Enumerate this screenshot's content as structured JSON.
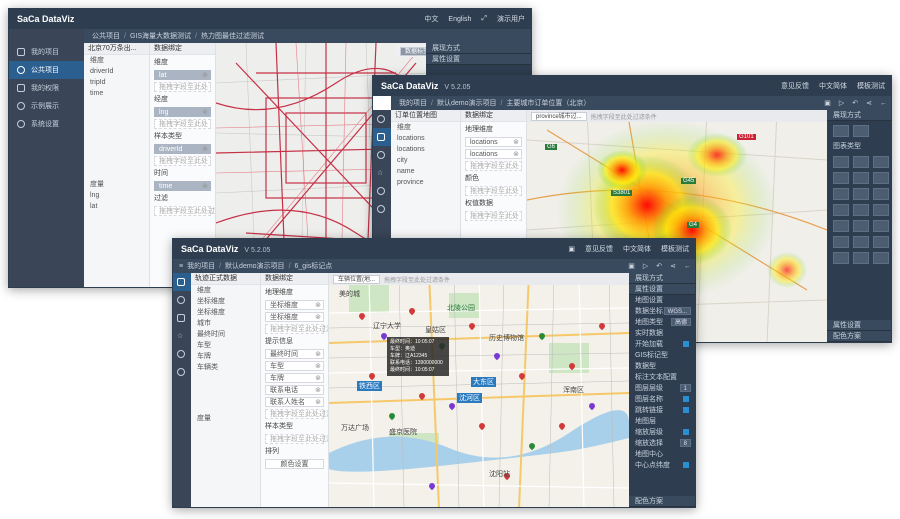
{
  "back": {
    "logo": "SaCa DataViz",
    "top": [
      "中文",
      "English",
      "演示用户"
    ],
    "crumbs": [
      "公共项目",
      "GIS海量大数据测试",
      "热力图最佳过滤测试"
    ],
    "nav": [
      "我的项目",
      "公共项目",
      "我的权限",
      "示例展示",
      "系统设置"
    ],
    "chart_title": "北京70万条出...",
    "dim_header": "维度",
    "dims": [
      "driverId",
      "tripId",
      "time"
    ],
    "measure_header": "度量",
    "measures": [
      "lng",
      "lat"
    ],
    "data_header": "数据绑定",
    "sec_dim": "维度",
    "f_lat": "lat",
    "sec_lng": "经度",
    "f_lng": "lng",
    "sec_style": "样本类型",
    "f_driver": "driverId",
    "sec_time": "时间",
    "f_time": "time",
    "sec_filter": "过滤",
    "drop_hint": "拖拽字段至此处",
    "drop_filter": "拖拽字段至此处过滤条件",
    "map_tabs": [
      "数据标签",
      "driverId筛选..."
    ],
    "right": [
      "展现方式",
      "属性设置"
    ]
  },
  "mid": {
    "logo": "SaCa DataViz",
    "version": "V 5.2.05",
    "top": [
      "意见反馈",
      "中文简体",
      "模板测试"
    ],
    "crumbs": [
      "我的项目",
      "默认demo演示项目",
      "主要城市订单位置（北京）"
    ],
    "chart_title": "订单位置地图",
    "dim_header": "维度",
    "dims": [
      "locations",
      "locations",
      "city",
      "name",
      "province"
    ],
    "measure_header": "度量",
    "data_header": "数据绑定",
    "sec_geo": "地理维度",
    "f_loc1": "locations",
    "f_loc2": "locations",
    "sec_color": "颜色",
    "sec_weight": "权值数据",
    "drop_hint": "拖拽字段至此处",
    "map_tabs": [
      "province城市过...",
      "拖拽字段至此处过滤条件"
    ],
    "right_header": "展现方式",
    "right_sec1": "图表类型",
    "right_sec2": "属性设置",
    "right_sec3": "配色方案",
    "roads": [
      "G101",
      "G6",
      "G45",
      "S3801",
      "G4"
    ]
  },
  "front": {
    "logo": "SaCa DataViz",
    "version": "V 5.2.05",
    "top": [
      "意见反馈",
      "中文简体",
      "模板测试"
    ],
    "crumbs": [
      "我的项目",
      "默认demo演示项目",
      "6_gis标记点"
    ],
    "chart_title": "轨迹正式数据",
    "dim_header": "维度",
    "dims": [
      "坐标维度",
      "坐标维度",
      "城市",
      "最终时间",
      "车型",
      "车牌",
      "车辆类"
    ],
    "measure_header": "度量",
    "data_header": "数据绑定",
    "sec_geo": "地理维度",
    "f_geo1": "坐标维度",
    "f_geo2": "坐标维度",
    "drop_hint": "拖拽字段至此处过滤条件",
    "sec_tip": "提示信息",
    "tips": [
      "最终时间",
      "车型",
      "车牌",
      "联系电话",
      "联系人姓名"
    ],
    "sec_style": "样本类型",
    "sec_show": "排列",
    "btn_save": "颜色设置",
    "map_tabs": [
      "车辆位置(地...",
      "拖拽字段至此处过滤条件"
    ],
    "tooltip": [
      "最终时间：10:05:07",
      "车型：奥迪",
      "车牌：辽A12345",
      "联系电话：1390000000",
      "最终时间：10:05:07"
    ],
    "place_labels": [
      "美的城",
      "辽宁大学",
      "北陵公园",
      "皇姑区",
      "铁西区",
      "沈河区",
      "大东区",
      "浑南区",
      "万达广场",
      "盛京医院",
      "历史博物馆",
      "沈阳站"
    ],
    "right_header": "展现方式",
    "right_items": [
      "属性设置",
      "地图设置",
      "数据坐标系",
      "地图类型",
      "实时数据",
      "开始加载",
      "GIS标记型",
      "数据型",
      "标注文本配置",
      "图层层级",
      "图层名称",
      "跳转链接",
      "地图层",
      "缩放层级",
      "缩放选择",
      "地图中心",
      "中心点纬度",
      "配色方案"
    ],
    "right_vals": [
      "WGS...",
      "高德",
      "1",
      "8"
    ]
  }
}
